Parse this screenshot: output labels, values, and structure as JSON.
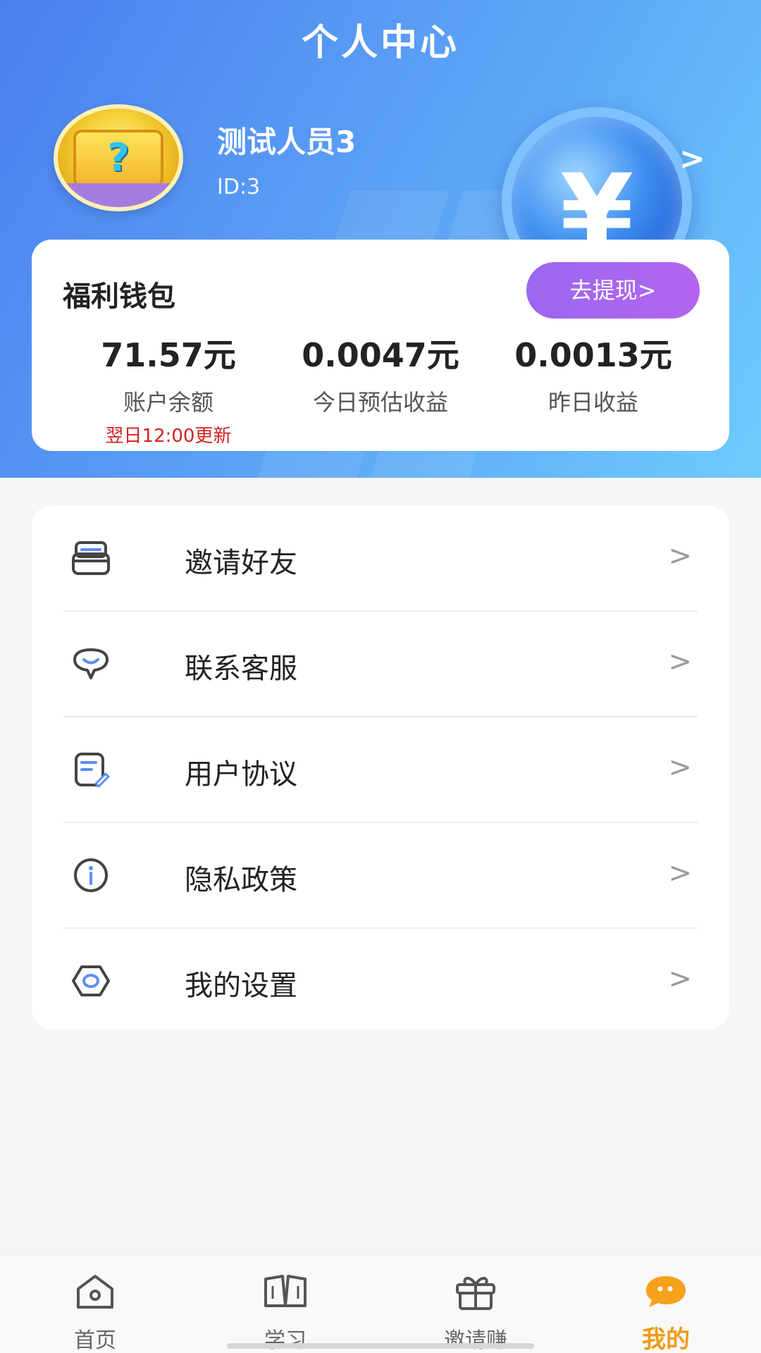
{
  "header": {
    "title": "个人中心",
    "user_name": "测试人员3",
    "user_id": "ID:3",
    "arrow": ">",
    "coin_symbol": "¥"
  },
  "wallet": {
    "title": "福利钱包",
    "withdraw_label": "去提现>",
    "stats": [
      {
        "value": "71.57元",
        "label": "账户余额",
        "note": "翌日12:00更新"
      },
      {
        "value": "0.0047元",
        "label": "今日预估收益"
      },
      {
        "value": "0.0013元",
        "label": "昨日收益"
      }
    ]
  },
  "menu": {
    "items": [
      {
        "label": "邀请好友",
        "icon": "invite-icon",
        "arrow": ">"
      },
      {
        "label": "联系客服",
        "icon": "chat-bubble-icon",
        "arrow": ">"
      },
      {
        "label": "用户协议",
        "icon": "document-edit-icon",
        "arrow": ">"
      },
      {
        "label": "隐私政策",
        "icon": "info-icon",
        "arrow": ">"
      },
      {
        "label": "我的设置",
        "icon": "settings-hexagon-icon",
        "arrow": ">"
      }
    ]
  },
  "tabbar": {
    "tabs": [
      {
        "label": "首页",
        "icon": "home-icon",
        "active": false
      },
      {
        "label": "学习",
        "icon": "book-icon",
        "active": false
      },
      {
        "label": "邀请赚",
        "icon": "gift-icon",
        "active": false
      },
      {
        "label": "我的",
        "icon": "profile-bubble-icon",
        "active": true
      }
    ]
  },
  "colors": {
    "header_gradient_start": "#4b7ff0",
    "header_gradient_end": "#6ecbfd",
    "withdraw_button": "#a866f0",
    "active_tab": "#f29a1a",
    "note_red": "#d62222",
    "icon_accent": "#5b8ff2"
  }
}
